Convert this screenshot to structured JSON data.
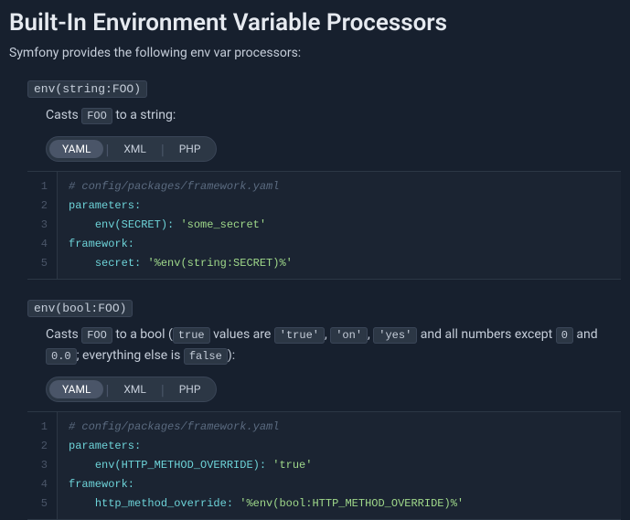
{
  "heading": "Built-In Environment Variable Processors",
  "intro": "Symfony provides the following env var processors:",
  "processors": [
    {
      "term": "env(string:FOO)",
      "desc_parts": [
        "Casts ",
        "FOO",
        " to a string:"
      ],
      "tabs": [
        "YAML",
        "XML",
        "PHP"
      ],
      "active_tab": "YAML",
      "code": [
        {
          "comment": "# config/packages/framework.yaml"
        },
        {
          "key": "parameters:"
        },
        {
          "indent": 1,
          "key": "env(SECRET):",
          "str": "'some_secret'"
        },
        {
          "key": "framework:"
        },
        {
          "indent": 1,
          "key": "secret:",
          "str": "'%env(string:SECRET)%'"
        }
      ]
    },
    {
      "term": "env(bool:FOO)",
      "desc_parts": [
        "Casts ",
        "FOO",
        " to a bool (",
        "true",
        " values are ",
        "'true'",
        ", ",
        "'on'",
        ", ",
        "'yes'",
        " and all numbers except ",
        "0",
        " and ",
        "0.0",
        "; everything else is ",
        "false",
        "):"
      ],
      "tabs": [
        "YAML",
        "XML",
        "PHP"
      ],
      "active_tab": "YAML",
      "code": [
        {
          "comment": "# config/packages/framework.yaml"
        },
        {
          "key": "parameters:"
        },
        {
          "indent": 1,
          "key": "env(HTTP_METHOD_OVERRIDE):",
          "str": "'true'"
        },
        {
          "key": "framework:"
        },
        {
          "indent": 1,
          "key": "http_method_override:",
          "str": "'%env(bool:HTTP_METHOD_OVERRIDE)%'"
        }
      ]
    }
  ]
}
